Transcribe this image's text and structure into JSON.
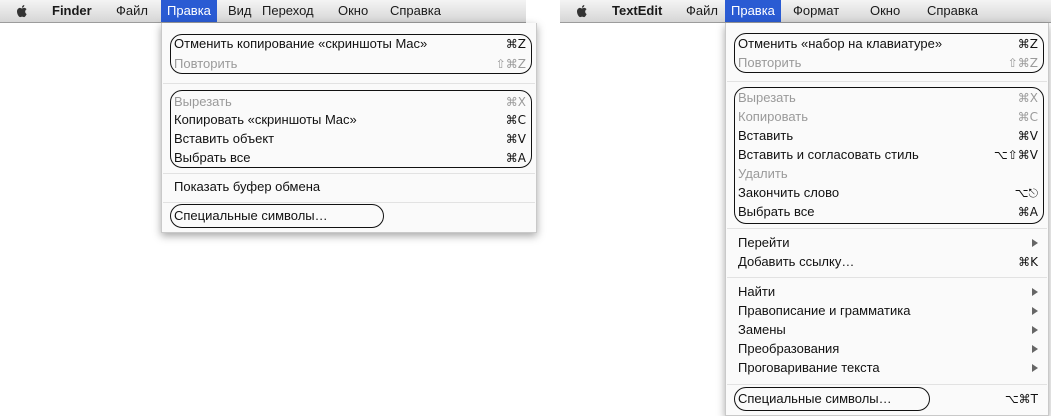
{
  "left": {
    "menubar": [
      "Finder",
      "Файл",
      "Правка",
      "Вид",
      "Переход",
      "Окно",
      "Справка"
    ],
    "menu": {
      "items": [
        {
          "label": "Отменить копирование «скриншоты Mac»",
          "shortcut": "⌘Z"
        },
        {
          "label": "Повторить",
          "shortcut": "⇧⌘Z"
        },
        {
          "label": "Вырезать",
          "shortcut": "⌘X"
        },
        {
          "label": "Копировать «скриншоты Mac»",
          "shortcut": "⌘C"
        },
        {
          "label": "Вставить объект",
          "shortcut": "⌘V"
        },
        {
          "label": "Выбрать все",
          "shortcut": "⌘A"
        },
        {
          "label": "Показать буфер обмена",
          "shortcut": ""
        },
        {
          "label": "Специальные символы…",
          "shortcut": ""
        }
      ]
    }
  },
  "right": {
    "menubar": [
      "TextEdit",
      "Файл",
      "Правка",
      "Формат",
      "Окно",
      "Справка"
    ],
    "menu": {
      "items": [
        {
          "label": "Отменить «набор на клавиатуре»",
          "shortcut": "⌘Z"
        },
        {
          "label": "Повторить",
          "shortcut": "⇧⌘Z"
        },
        {
          "label": "Вырезать",
          "shortcut": "⌘X"
        },
        {
          "label": "Копировать",
          "shortcut": "⌘C"
        },
        {
          "label": "Вставить",
          "shortcut": "⌘V"
        },
        {
          "label": "Вставить и согласовать стиль",
          "shortcut": "⌥⇧⌘V"
        },
        {
          "label": "Удалить",
          "shortcut": ""
        },
        {
          "label": "Закончить слово",
          "shortcut": "⌥⎋"
        },
        {
          "label": "Выбрать все",
          "shortcut": "⌘A"
        },
        {
          "label": "Перейти",
          "shortcut": ""
        },
        {
          "label": "Добавить ссылку…",
          "shortcut": "⌘K"
        },
        {
          "label": "Найти",
          "shortcut": ""
        },
        {
          "label": "Правописание и грамматика",
          "shortcut": ""
        },
        {
          "label": "Замены",
          "shortcut": ""
        },
        {
          "label": "Преобразования",
          "shortcut": ""
        },
        {
          "label": "Проговаривание текста",
          "shortcut": ""
        },
        {
          "label": "Специальные символы…",
          "shortcut": "⌥⌘T"
        }
      ]
    }
  },
  "colors": {
    "highlight": "#2a5bd3",
    "disabled": "#9a9a9a"
  },
  "icons": {
    "apple": "apple-icon",
    "submenu": "submenu-arrow-icon"
  }
}
